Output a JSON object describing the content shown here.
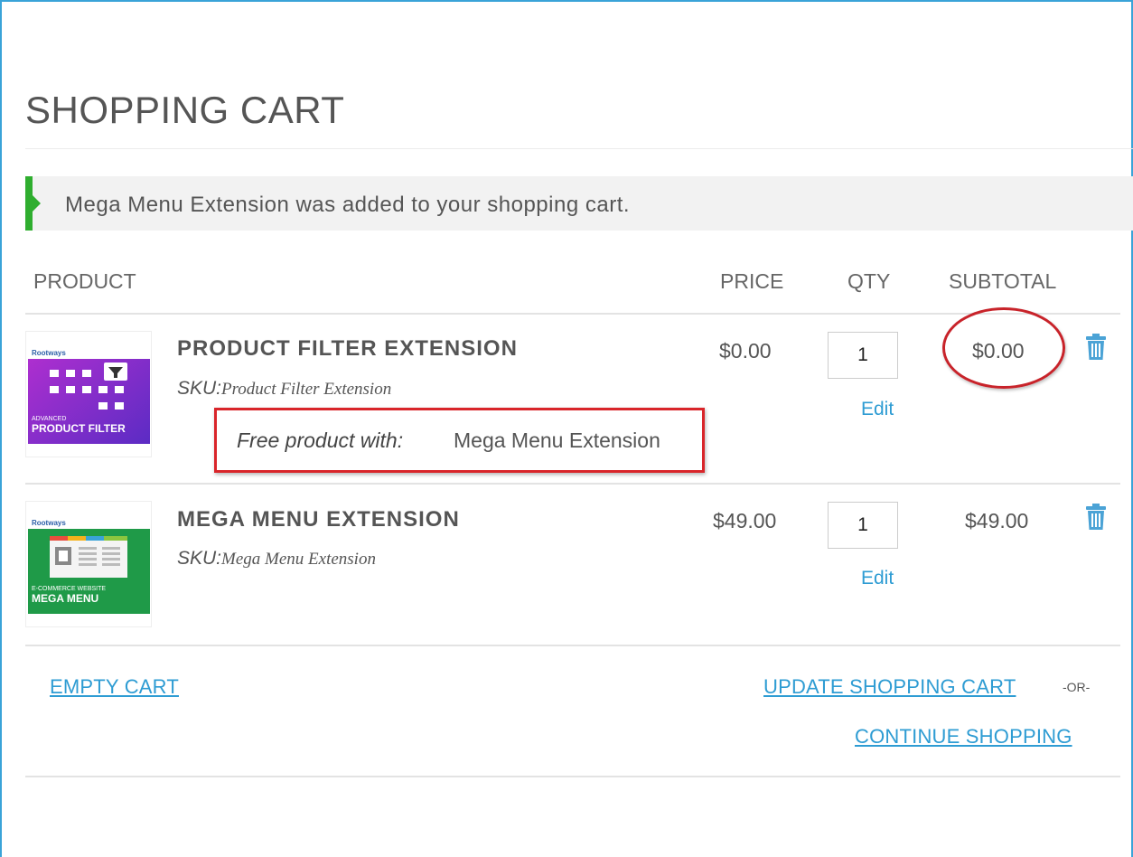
{
  "page": {
    "title": "SHOPPING CART"
  },
  "message": {
    "text": "Mega Menu Extension was added to your shopping cart."
  },
  "table_headers": {
    "product": "PRODUCT",
    "price": "PRICE",
    "qty": "QTY",
    "subtotal": "SUBTOTAL"
  },
  "items": [
    {
      "name": "PRODUCT FILTER EXTENSION",
      "sku_label": "SKU:",
      "sku": "Product Filter Extension",
      "price": "$0.00",
      "qty": "1",
      "edit_label": "Edit",
      "subtotal": "$0.00",
      "free_label": "Free product with:",
      "free_value": "Mega Menu Extension",
      "thumb": {
        "brand": "Rootways",
        "line1": "ADVANCED",
        "line2": "PRODUCT FILTER",
        "color": "#7b2fc9"
      }
    },
    {
      "name": "MEGA MENU EXTENSION",
      "sku_label": "SKU:",
      "sku": "Mega Menu Extension",
      "price": "$49.00",
      "qty": "1",
      "edit_label": "Edit",
      "subtotal": "$49.00",
      "thumb": {
        "brand": "Rootways",
        "line1": "E-COMMERCE WEBSITE",
        "line2": "MEGA MENU",
        "color": "#1f9a48"
      }
    }
  ],
  "actions": {
    "empty_cart": "EMPTY CART",
    "update_cart": "UPDATE SHOPPING CART",
    "or": "-OR-",
    "continue_shopping": "CONTINUE SHOPPING"
  },
  "colors": {
    "accent_link": "#2e9cd3",
    "success": "#2fae2f",
    "highlight": "#d9252a"
  }
}
